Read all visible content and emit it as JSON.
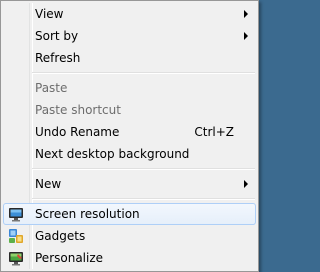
{
  "menu": {
    "view": "View",
    "sort_by": "Sort by",
    "refresh": "Refresh",
    "paste": "Paste",
    "paste_shortcut": "Paste shortcut",
    "undo_rename": "Undo Rename",
    "undo_rename_shortcut": "Ctrl+Z",
    "next_desktop_background": "Next desktop background",
    "new": "New",
    "screen_resolution": "Screen resolution",
    "gadgets": "Gadgets",
    "personalize": "Personalize"
  },
  "icons": {
    "screen_resolution": "monitor-icon",
    "gadgets": "gadgets-icon",
    "personalize": "personalize-icon"
  },
  "colors": {
    "menu_background": "#f0f0f0",
    "hover_border": "#aecff7",
    "disabled_text": "#6d6d6d"
  }
}
